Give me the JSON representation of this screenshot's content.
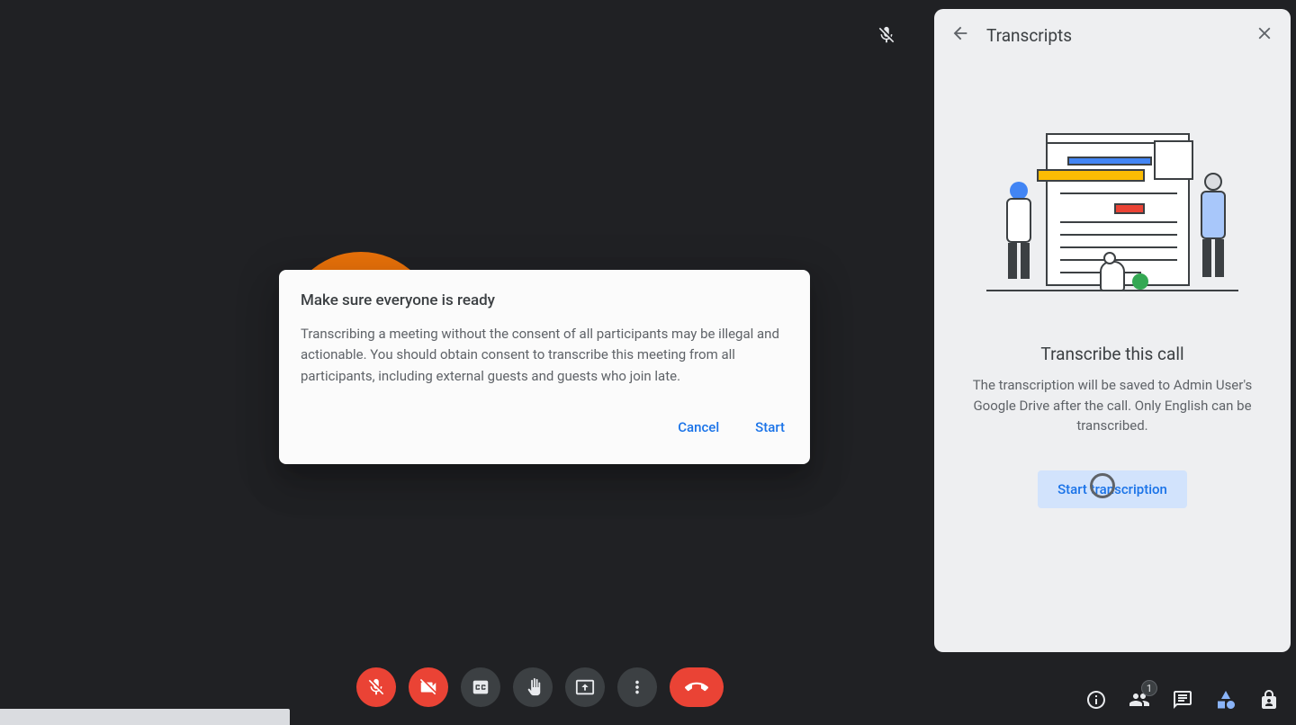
{
  "dialog": {
    "title": "Make sure everyone is ready",
    "body": "Transcribing a meeting without the consent of all participants may be illegal and actionable. You should obtain consent to transcribe this meeting from all participants, including external guests and guests who join late.",
    "cancel_label": "Cancel",
    "start_label": "Start"
  },
  "panel": {
    "title": "Transcripts",
    "heading": "Transcribe this call",
    "description": "The transcription will be saved to Admin User's Google Drive after the call. Only English can be transcribed.",
    "start_button": "Start transcription"
  },
  "participants": {
    "badge": "1"
  }
}
